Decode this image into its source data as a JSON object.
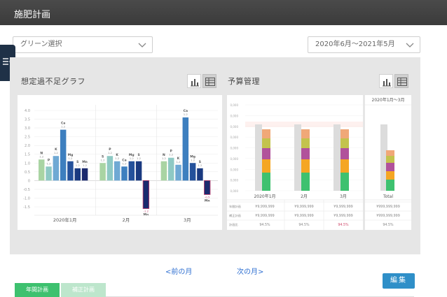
{
  "app": {
    "title": "施肥計画"
  },
  "filters": {
    "green_select": "グリーン選択",
    "period": "2020年6月～2021年5月"
  },
  "sections": {
    "shortage_title": "想定過不足グラフ",
    "budget_title": "予算管理"
  },
  "nav": {
    "prev": "<前の月",
    "next": "次の月>"
  },
  "buttons": {
    "edit": "編集"
  },
  "tabs": [
    {
      "label": "年間計画"
    },
    {
      "label": "補正計画"
    }
  ],
  "colors": {
    "topbar": "#3b3b3b",
    "panel": "#e6e6e6",
    "edit": "#2f8fc8",
    "tab_active": "#3ec16f",
    "tab_inactive": "#bde6cc",
    "nutrients": [
      "#a9d4a3",
      "#8ec9c4",
      "#6fa9d4",
      "#3d7fbf",
      "#24519b",
      "#1a3a80",
      "#1b2a6e"
    ]
  },
  "chart_data": [
    {
      "type": "bar",
      "title": "想定過不足グラフ",
      "ylim": [
        -1.5,
        4.0
      ],
      "y_ticks": [
        "4.0",
        "3.5",
        "3.0",
        "2.5",
        "2.0",
        "1.5",
        "1.0",
        "0.5",
        "0",
        "-0.5",
        "-1.0",
        "-1.5"
      ],
      "nutrients": [
        "N",
        "P",
        "K",
        "Ca",
        "Mg",
        "S",
        "Mn"
      ],
      "categories": [
        "2020年1月",
        "2月",
        "3月"
      ],
      "groups": [
        {
          "month": "2020年1月",
          "values": [
            1.2,
            0.8,
            1.4,
            2.9,
            1.1,
            0.7,
            0.7
          ],
          "labels": [
            "N",
            "P",
            "K",
            "Ca",
            "Mg",
            "S",
            "Mn"
          ],
          "values_text": [
            "1.2",
            "1.2",
            "1.2",
            "1.2",
            "1.2",
            "1.2",
            "1.2"
          ]
        },
        {
          "month": "2月",
          "values": [
            1.0,
            1.4,
            1.1,
            0.8,
            1.1,
            1.1,
            -1.6
          ],
          "labels": [
            "S",
            "P",
            "K",
            "Ca",
            "Mg",
            "S",
            "Mn"
          ],
          "values_text": [
            "1.2",
            "1.2",
            "1.2",
            "1.2",
            "1.2",
            "1.2",
            "-1.2"
          ]
        },
        {
          "month": "3月",
          "values": [
            1.1,
            1.3,
            0.9,
            3.6,
            1.0,
            0.7,
            -0.8
          ],
          "labels": [
            "N",
            "P",
            "K",
            "Ca",
            "Mg",
            "S",
            "Mn"
          ],
          "values_text": [
            "1.2",
            "1.2",
            "1.2",
            "1.2",
            "1.2",
            "1.2",
            "-0.5"
          ]
        }
      ]
    },
    {
      "type": "bar",
      "title": "予算管理",
      "categories": [
        "2020年1月",
        "2月",
        "3月"
      ],
      "total_label": "Total",
      "total_header": "2020年1月～3月",
      "stack_colors": [
        "#3ec16f",
        "#f5a623",
        "#b1529b",
        "#c3c34d",
        "#f0a878"
      ],
      "rows": [
        {
          "label": "年間計画",
          "values": [
            "¥9,999,999",
            "¥9,999,999",
            "¥9,999,999"
          ],
          "total": "¥999,999,999"
        },
        {
          "label": "補正計画",
          "values": [
            "¥9,999,999",
            "¥9,999,999",
            "¥9,999,999"
          ],
          "total": "¥999,999,999"
        },
        {
          "label": "計画比",
          "values": [
            "94.5%",
            "94.5%",
            "94.5%"
          ],
          "total": "94.5%"
        }
      ]
    }
  ]
}
